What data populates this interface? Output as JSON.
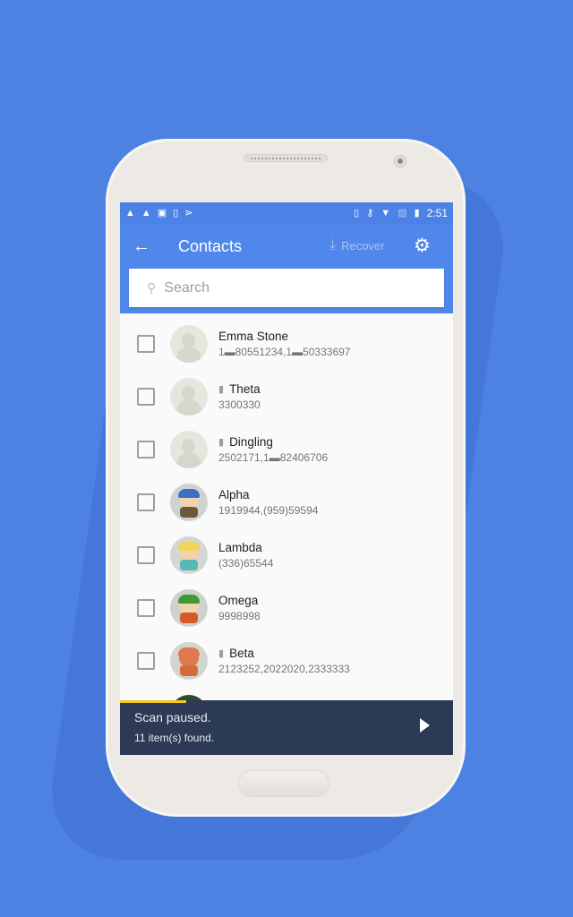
{
  "statusbar": {
    "left_icons": [
      "warning-icon",
      "warning-icon",
      "image-icon",
      "download-icon",
      "checklist-icon"
    ],
    "right_icons": [
      "vibrate-icon",
      "key-icon",
      "wifi-off-icon",
      "no-sim-icon",
      "battery-charging-icon"
    ],
    "time": "2:51"
  },
  "toolbar": {
    "back_icon": "←",
    "title": "Contacts",
    "recover_label": "Recover",
    "recover_icon": "⤓",
    "settings_icon": "⚙"
  },
  "search": {
    "placeholder": "Search",
    "value": "",
    "icon": "🔍"
  },
  "contacts": [
    {
      "name": "Emma Stone",
      "numbers": "1▬80551234,1▬50333697",
      "deleted": false,
      "avatar": "default"
    },
    {
      "name": "Theta",
      "numbers": "3300330",
      "deleted": true,
      "avatar": "default"
    },
    {
      "name": "Dingling",
      "numbers": "2502171,1▬82406706",
      "deleted": true,
      "avatar": "default"
    },
    {
      "name": "Alpha",
      "numbers": "1919944,(959)59594",
      "deleted": false,
      "avatar": "photo-blue-hat"
    },
    {
      "name": "Lambda",
      "numbers": "(336)65544",
      "deleted": false,
      "avatar": "photo-blonde"
    },
    {
      "name": "Omega",
      "numbers": "9998998",
      "deleted": false,
      "avatar": "photo-green-hat"
    },
    {
      "name": "Beta",
      "numbers": "2123252,2022020,2333333",
      "deleted": true,
      "avatar": "photo-orange-hood"
    }
  ],
  "trash_icon": "🗑",
  "scan": {
    "status": "Scan paused.",
    "count": "11 item(s) found.",
    "progress": 0.2,
    "accent": "#f2c81e",
    "background": "#2c3a55"
  },
  "colors": {
    "primary": "#4f87ea",
    "background": "#4d82e2"
  }
}
